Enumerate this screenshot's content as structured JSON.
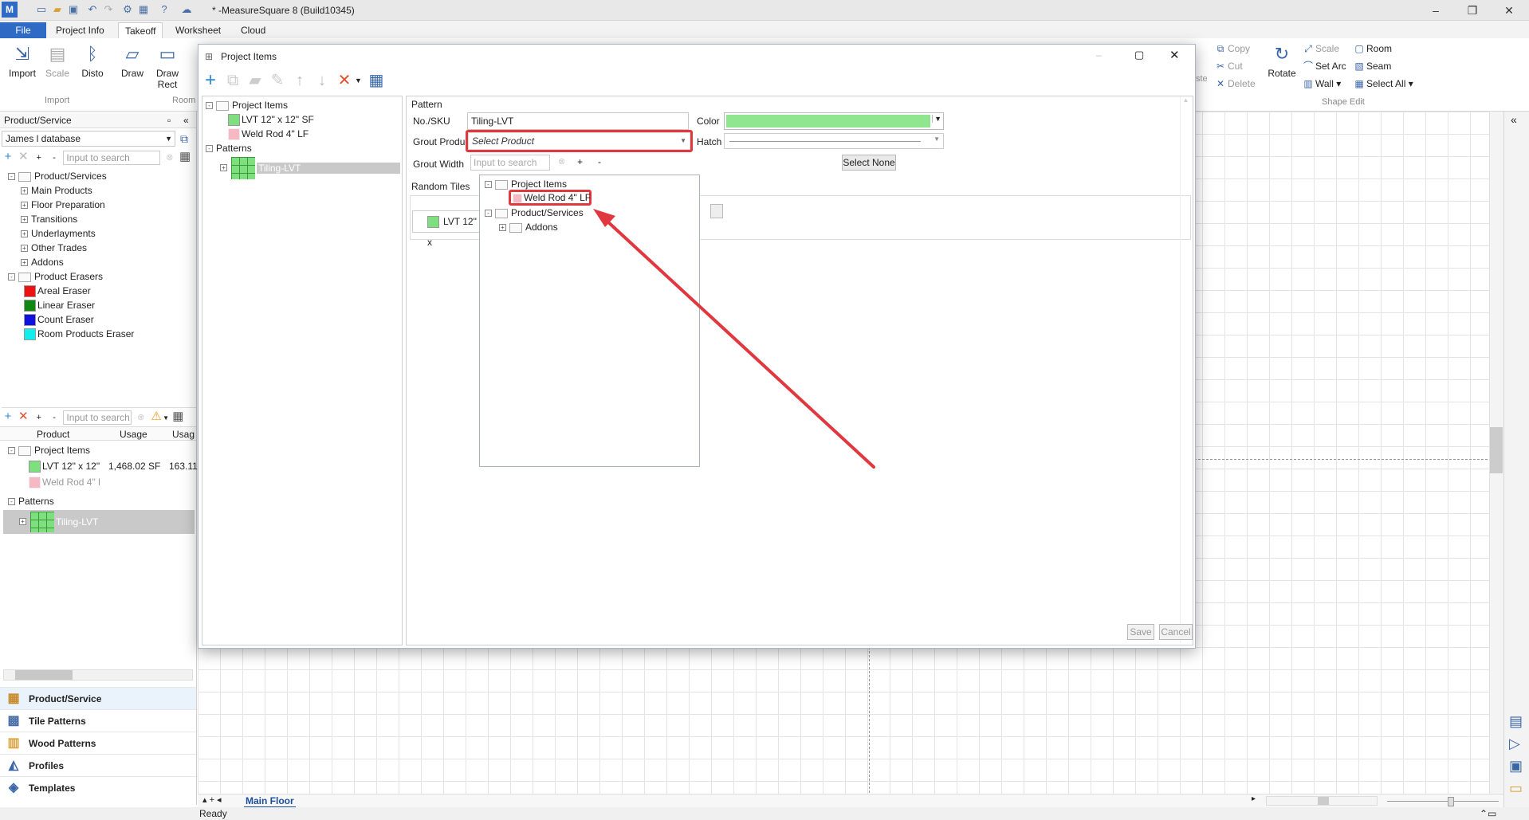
{
  "app": {
    "title": "* -MeasureSquare 8 (Build10345)",
    "status": "Ready",
    "logo": "M"
  },
  "tabs": [
    "File",
    "Project Info",
    "Takeoff",
    "Worksheet",
    "Cloud"
  ],
  "ribbon": {
    "buttons": [
      "Import",
      "Scale",
      "Disto",
      "Draw",
      "Draw\nRect",
      "Rotate"
    ],
    "groups": [
      "Import",
      "Room",
      "Shape Edit"
    ],
    "small": [
      "Copy",
      "Cut",
      "Delete",
      "Scale",
      "Set Arc",
      "Wall",
      "Room",
      "Seam",
      "Select All",
      "ste",
      "te"
    ]
  },
  "left": {
    "panel_title": "Product/Service",
    "database": "James l database",
    "search_placeholder": "Input to search",
    "tree": [
      {
        "label": "Product/Services",
        "level": 0,
        "exp": "-"
      },
      {
        "label": "Main Products",
        "level": 1,
        "exp": "+"
      },
      {
        "label": "Floor Preparation",
        "level": 1,
        "exp": "+"
      },
      {
        "label": "Transitions",
        "level": 1,
        "exp": "+"
      },
      {
        "label": "Underlayments",
        "level": 1,
        "exp": "+"
      },
      {
        "label": "Other Trades",
        "level": 1,
        "exp": "+"
      },
      {
        "label": "Addons",
        "level": 1,
        "exp": "+"
      },
      {
        "label": "Product Erasers",
        "level": 0,
        "exp": "-"
      }
    ],
    "erasers": [
      {
        "label": "Areal Eraser",
        "color": "#ee1111"
      },
      {
        "label": "Linear Eraser",
        "color": "#118811"
      },
      {
        "label": "Count Eraser",
        "color": "#1111dd"
      },
      {
        "label": "Room Products Eraser",
        "color": "#11eeee"
      }
    ],
    "usage_columns": [
      "Product",
      "Usage",
      "Usag"
    ],
    "usage_root": "Project Items",
    "usage_rows": [
      {
        "product": "LVT 12\" x 12\"",
        "usage": "1,468.02 SF",
        "usage2": "163.11",
        "color": "#7ddf7d"
      },
      {
        "product": "Weld Rod 4\" l",
        "usage": "",
        "usage2": "",
        "color": "#f6b8c2"
      }
    ],
    "patterns_label": "Patterns",
    "pattern_item": "Tiling-LVT",
    "nav": [
      "Product/Service",
      "Tile Patterns",
      "Wood Patterns",
      "Profiles",
      "Templates"
    ]
  },
  "dialog": {
    "title": "Project Items",
    "tree": {
      "root": "Project Items",
      "items": [
        "LVT 12\" x 12\" SF",
        "Weld Rod 4\" LF"
      ],
      "patterns": "Patterns",
      "pattern": "Tiling-LVT"
    },
    "section": "Pattern",
    "sku_label": "No./SKU",
    "sku_value": "Tiling-LVT",
    "color_label": "Color",
    "color_value": "#8fe68f",
    "grout_label": "Grout Product",
    "grout_placeholder": "Select Product",
    "hatch_label": "Hatch",
    "width_label": "Grout Width",
    "random_label": "Random Tiles",
    "random_row": "LVT 12\" x",
    "search_placeholder": "Input to search",
    "select_none": "Select None",
    "popup": {
      "root": "Project Items",
      "item": "Weld Rod 4\" LF",
      "services": "Product/Services",
      "addons": "Addons"
    },
    "save": "Save",
    "cancel": "Cancel"
  },
  "sheet": {
    "tab": "Main Floor"
  }
}
